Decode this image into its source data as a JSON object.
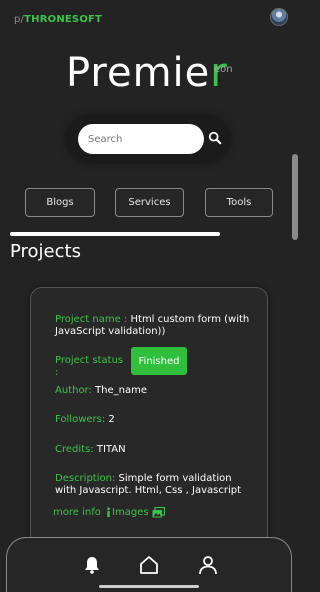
{
  "header": {
    "brand_prefix": "p/",
    "brand_name": "THRONESOFT",
    "logo_main": "Premie",
    "logo_accent": "r",
    "logo_sub": "eon"
  },
  "search": {
    "placeholder": "Search",
    "value": ""
  },
  "nav": {
    "items": [
      {
        "label": "Blogs"
      },
      {
        "label": "Services"
      },
      {
        "label": "Tools"
      }
    ]
  },
  "main": {
    "section_title": "Projects"
  },
  "project": {
    "name_label": "Project name :",
    "name_value": "Html custom form (with JavaScript validation))",
    "status_label": "Project status :",
    "status_value": "Finished",
    "author_label": "Author:",
    "author_value": "The_name",
    "followers_label": "Followers:",
    "followers_value": "2",
    "credits_label": "Credits:",
    "credits_value": "TITAN",
    "description_label": "Description:",
    "description_value": "Simple form validation with Javascript. Html, Css , Javascript",
    "more_info_label": "more info",
    "images_label": "Images"
  },
  "icons": {
    "search": "search-icon",
    "info": "info-icon",
    "images": "images-icon",
    "bell": "bell-icon",
    "home": "home-icon",
    "profile": "profile-icon"
  },
  "colors": {
    "accent": "#3cc24a",
    "background": "#232323",
    "badge": "#2fbf3d"
  }
}
